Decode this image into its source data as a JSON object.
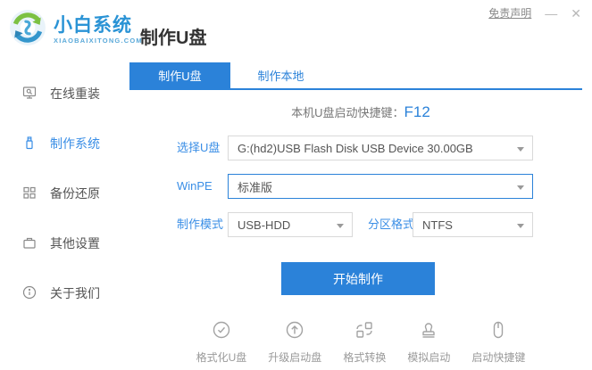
{
  "window": {
    "disclaimer": "免责声明",
    "minimize_icon": "—",
    "close_icon": "✕"
  },
  "header": {
    "logo_title": "小白系统",
    "logo_subtitle": "XIAOBAIXITONG.COM",
    "page_title": "制作U盘"
  },
  "sidebar": {
    "items": [
      {
        "label": "在线重装",
        "icon": "monitor-icon",
        "active": false
      },
      {
        "label": "制作系统",
        "icon": "usb-icon",
        "active": true
      },
      {
        "label": "备份还原",
        "icon": "backup-grid-icon",
        "active": false
      },
      {
        "label": "其他设置",
        "icon": "briefcase-icon",
        "active": false
      },
      {
        "label": "关于我们",
        "icon": "info-icon",
        "active": false
      }
    ]
  },
  "tabs": [
    {
      "label": "制作U盘",
      "active": true
    },
    {
      "label": "制作本地",
      "active": false
    }
  ],
  "main": {
    "hotkey_label": "本机U盘启动快捷键：",
    "hotkey_value": "F12",
    "fields": {
      "usb_label": "选择U盘",
      "usb_value": "G:(hd2)USB Flash Disk USB Device 30.00GB",
      "winpe_label": "WinPE",
      "winpe_value": "标准版",
      "mode_label": "制作模式",
      "mode_value": "USB-HDD",
      "partition_label": "分区格式",
      "partition_value": "NTFS"
    },
    "start_button": "开始制作"
  },
  "footer": {
    "items": [
      {
        "label": "格式化U盘",
        "icon": "check-circle-icon"
      },
      {
        "label": "升级启动盘",
        "icon": "arrow-up-circle-icon"
      },
      {
        "label": "格式转换",
        "icon": "convert-icon"
      },
      {
        "label": "模拟启动",
        "icon": "stamp-icon"
      },
      {
        "label": "启动快捷键",
        "icon": "mouse-icon"
      }
    ]
  },
  "colors": {
    "accent_blue": "#2b82d9",
    "label_blue": "#3a8ee6",
    "logo_green": "#7cc142",
    "logo_blue": "#3496cc"
  }
}
